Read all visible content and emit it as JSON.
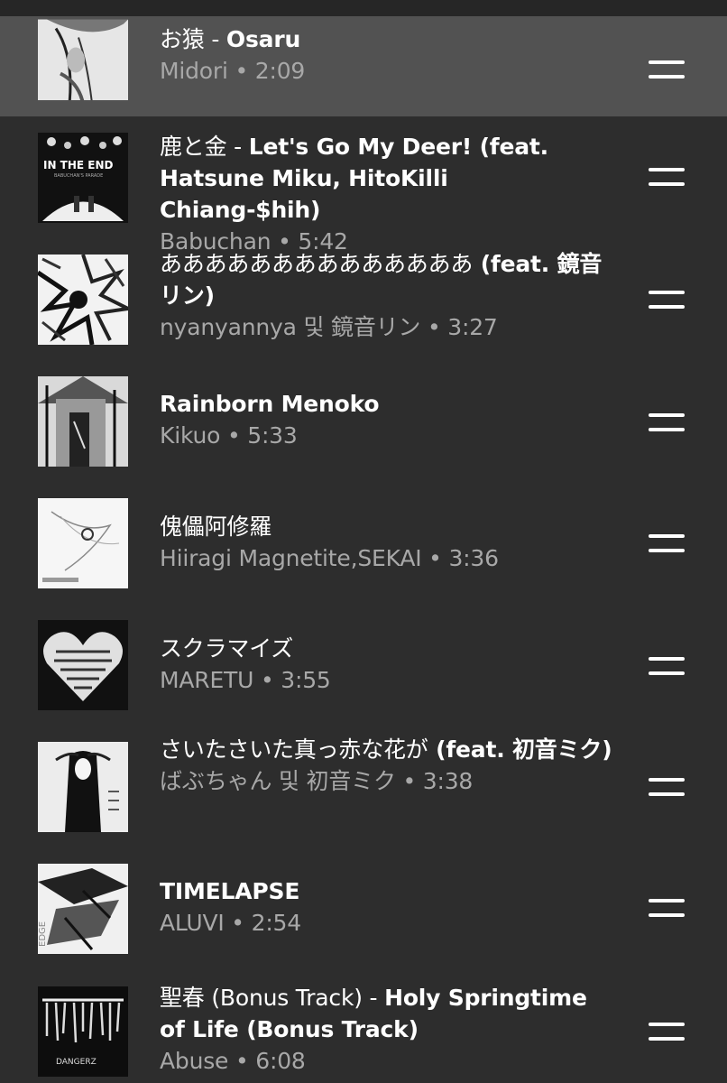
{
  "tracks": [
    {
      "title_jp": "お猿 - ",
      "title_en": "Osaru",
      "artist": "Midori",
      "duration": "2:09",
      "playing": true
    },
    {
      "title_jp": "鹿と金 - ",
      "title_en": "Let's Go My Deer! (feat. Hatsune Miku, HitoKilli Chiang-$hih)",
      "artist": "Babuchan",
      "duration": "5:42"
    },
    {
      "title_jp": "ああああああああああああああ",
      "title_en": " (feat. 鏡音リン)",
      "artist": "nyanyannya 및 鏡音リン",
      "duration": "3:27"
    },
    {
      "title_jp": "",
      "title_en": "Rainborn Menoko",
      "artist": "Kikuo",
      "duration": "5:33"
    },
    {
      "title_jp": "傀儡阿修羅",
      "title_en": "",
      "artist": "Hiiragi Magnetite,SEKAI",
      "duration": "3:36"
    },
    {
      "title_jp": "スクラマイズ",
      "title_en": "",
      "artist": "MARETU",
      "duration": "3:55"
    },
    {
      "title_jp": "さいたさいた真っ赤な花が",
      "title_en": " (feat. 初音ミク)",
      "artist": "ばぶちゃん 및 初音ミク",
      "duration": "3:38"
    },
    {
      "title_jp": "",
      "title_en": "TIMELAPSE",
      "artist": "ALUVI",
      "duration": "2:54"
    },
    {
      "title_jp": "聖春 (Bonus Track) - ",
      "title_en": "Holy Springtime of Life (Bonus Track)",
      "artist": "Abuse",
      "duration": "6:08"
    }
  ],
  "separator": " • ",
  "art": {
    "in_the_end_text": "IN THE END",
    "in_the_end_sub": "BABUCHAN'S PARADE",
    "edge_text": "EDGE",
    "abuse_text": "DANGERZ"
  },
  "colors": {
    "background": "#2d2d2d",
    "current_row": "#525252",
    "title": "#ffffff",
    "subtitle": "#a8a8a8"
  },
  "icons": {
    "drag_handle": "drag-handle-icon",
    "now_playing": "equalizer-icon"
  }
}
